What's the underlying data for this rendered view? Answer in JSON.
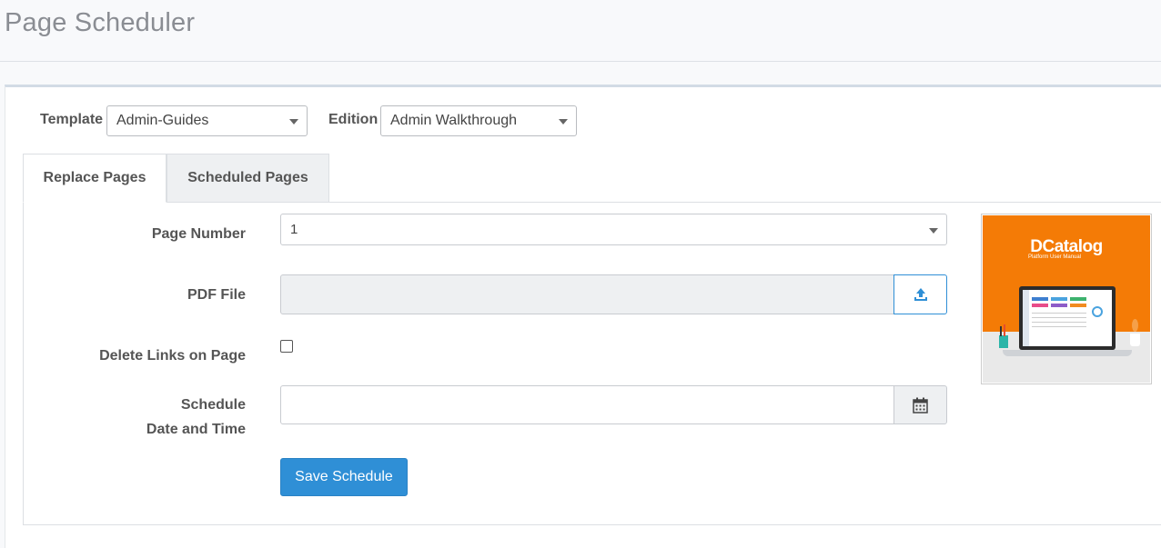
{
  "page": {
    "title": "Page Scheduler"
  },
  "filters": {
    "template_label": "Template",
    "template_value": "Admin-Guides",
    "edition_label": "Edition",
    "edition_value": "Admin Walkthrough"
  },
  "tabs": [
    {
      "label": "Replace Pages",
      "active": true
    },
    {
      "label": "Scheduled Pages",
      "active": false
    }
  ],
  "form": {
    "page_number_label": "Page Number",
    "page_number_value": "1",
    "pdf_file_label": "PDF File",
    "pdf_file_value": "",
    "delete_links_label": "Delete Links on Page",
    "delete_links_checked": false,
    "schedule_label_line1": "Schedule",
    "schedule_label_line2": "Date and Time",
    "schedule_value": "",
    "save_button": "Save Schedule"
  },
  "preview": {
    "brand": "DCatalog",
    "brand_subtitle": "Platform User Manual"
  },
  "colors": {
    "primary_button": "#2f8fd6",
    "thumbnail_bg": "#f47b06"
  },
  "icons": {
    "upload": "upload-icon",
    "calendar": "calendar-icon",
    "dropdown": "caret-down-icon"
  }
}
